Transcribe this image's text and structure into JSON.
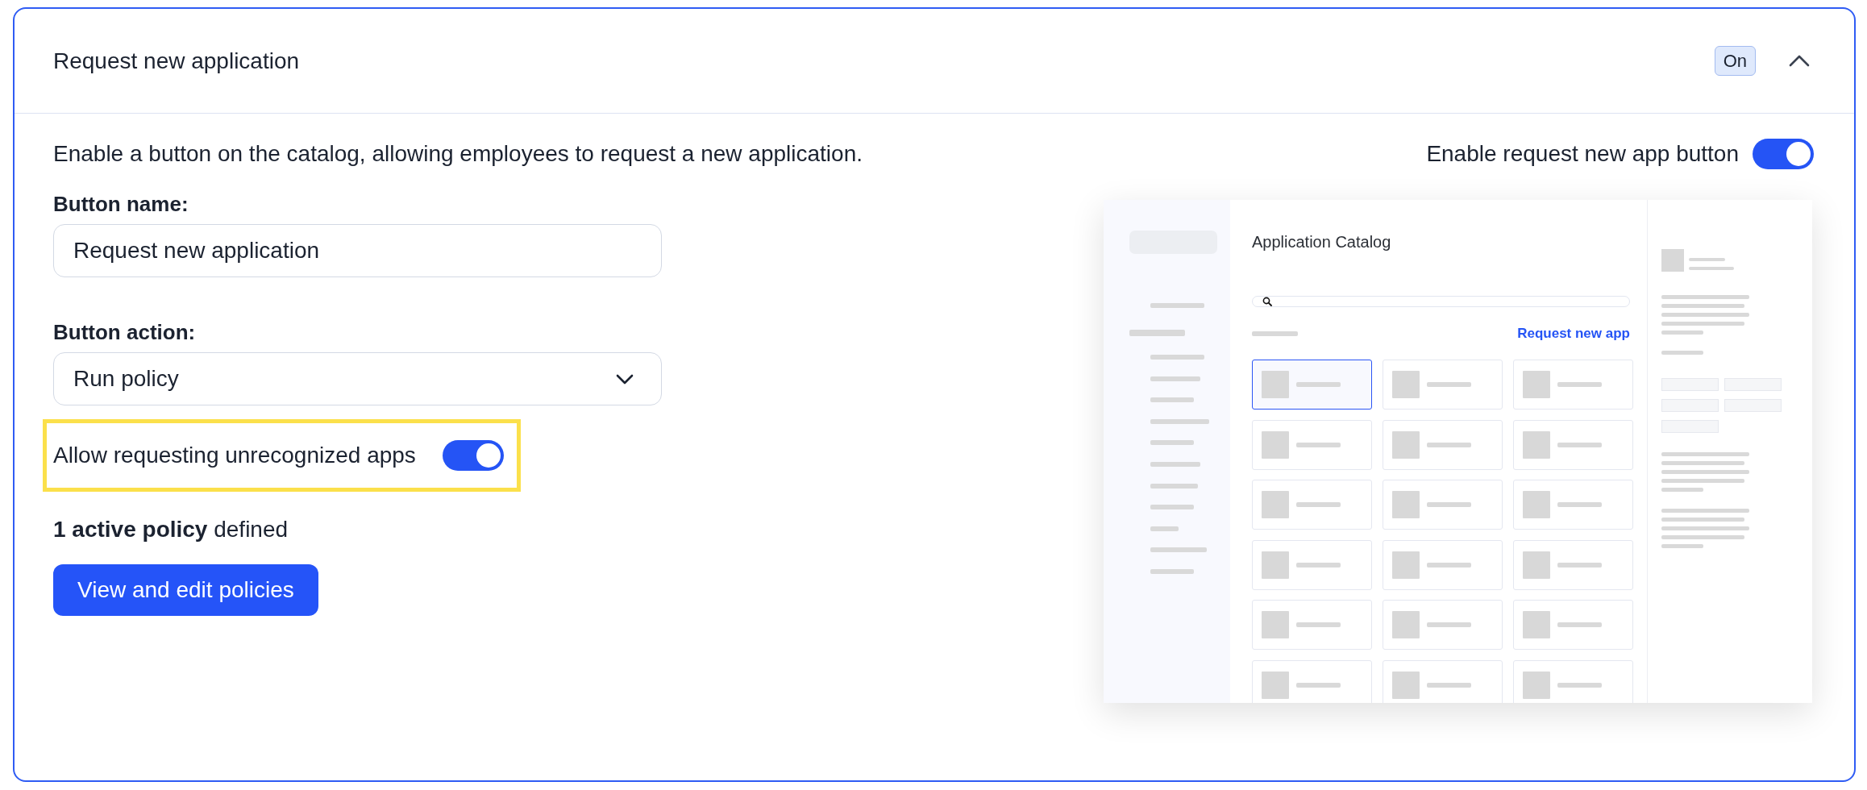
{
  "panel": {
    "title": "Request new application",
    "status_badge": "On",
    "expanded": true
  },
  "description": "Enable a button on the catalog, allowing employees to request a new application.",
  "enable_toggle": {
    "label": "Enable request new app button",
    "on": true
  },
  "button_name": {
    "label": "Button name:",
    "value": "Request new application"
  },
  "button_action": {
    "label": "Button action:",
    "value": "Run policy"
  },
  "unrecognized_apps_toggle": {
    "label": "Allow requesting unrecognized apps",
    "on": true,
    "highlighted": true
  },
  "policy_summary": "**1 active policy** defined",
  "policies_button": "View and edit policies",
  "preview": {
    "title": "Application Catalog",
    "link": "Request new app",
    "tiles": [
      {
        "selected": true
      },
      {
        "selected": false
      },
      {
        "selected": false
      },
      {
        "selected": false
      },
      {
        "selected": false
      },
      {
        "selected": false
      },
      {
        "selected": false
      },
      {
        "selected": false
      },
      {
        "selected": false
      },
      {
        "selected": false
      },
      {
        "selected": false
      },
      {
        "selected": false
      },
      {
        "selected": false
      },
      {
        "selected": false
      },
      {
        "selected": false
      },
      {
        "selected": false
      },
      {
        "selected": false
      },
      {
        "selected": false
      }
    ]
  }
}
